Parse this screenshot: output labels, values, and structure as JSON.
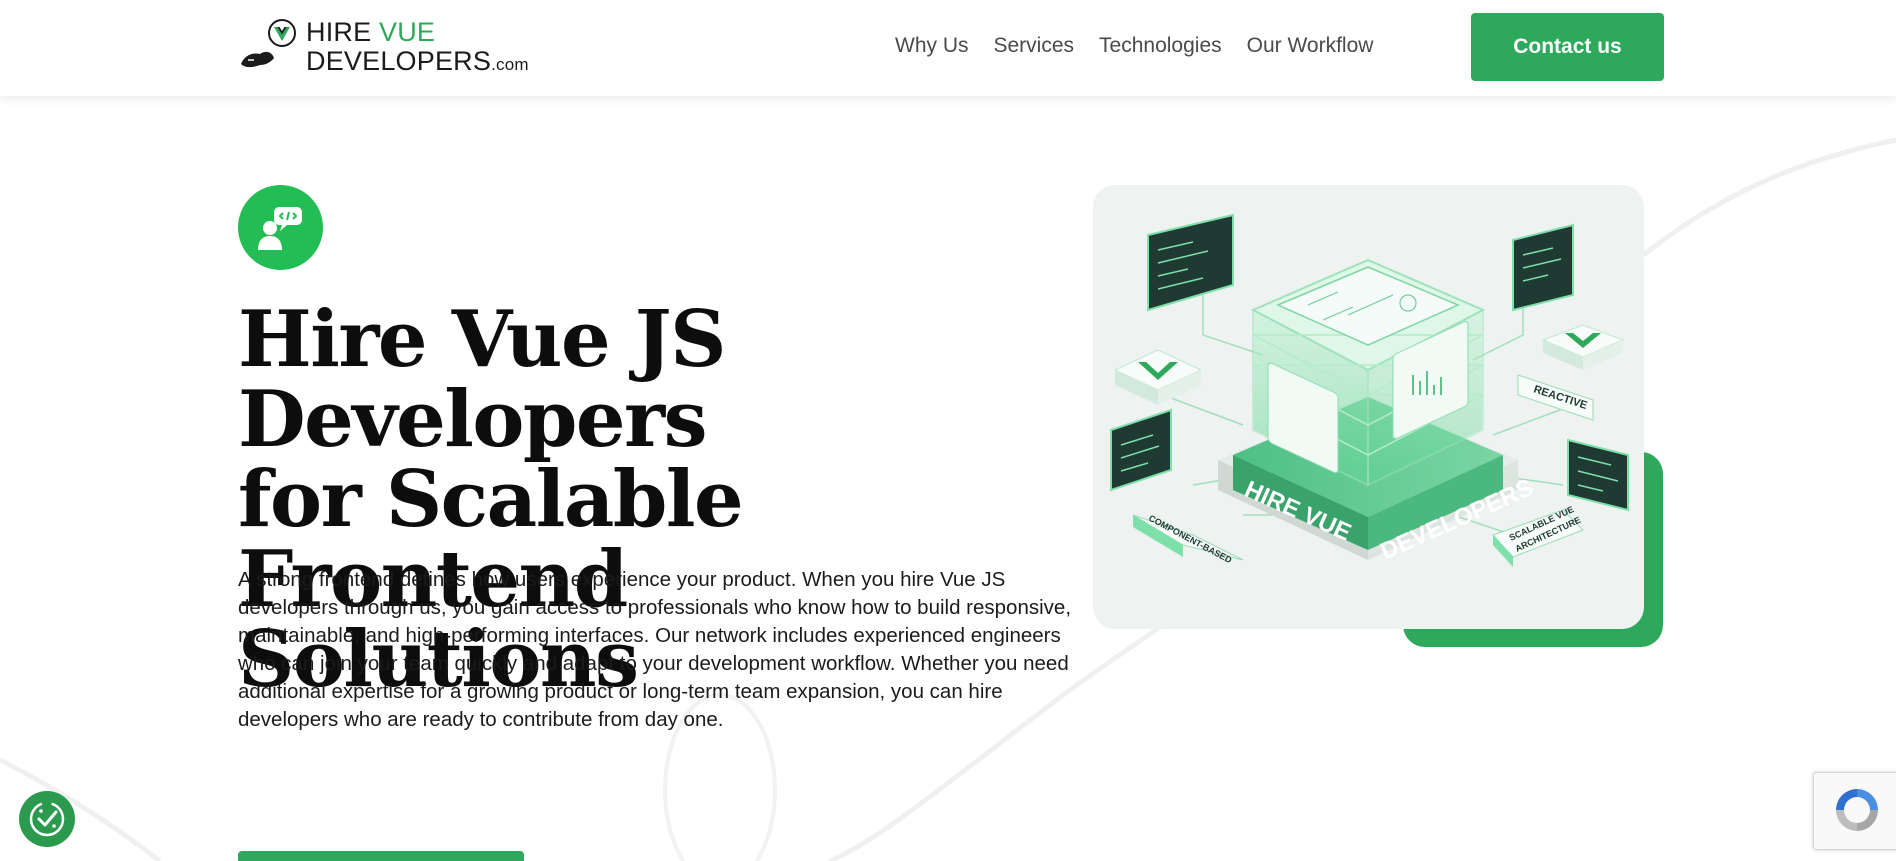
{
  "header": {
    "logo": {
      "word_hire": "HIRE",
      "word_vue": "VUE",
      "word_developers": "DEVELOPERS",
      "word_dotcom": ".com"
    },
    "nav": [
      {
        "label": "Why Us"
      },
      {
        "label": "Services"
      },
      {
        "label": "Technologies"
      },
      {
        "label": "Our Workflow"
      }
    ],
    "contact_label": "Contact us"
  },
  "hero": {
    "badge_icon": "developer-chat-icon",
    "title_line1": "Hire Vue JS Developers",
    "title_line2": "for Scalable Frontend",
    "title_line3": "Solutions",
    "description": "A strong frontend defines how users experience your product. When you hire Vue JS developers through us, you gain access to professionals who know how to build responsive, maintainable, and high-performing interfaces. Our network includes experienced engineers who can join your team quickly and adapt to your development workflow. Whether you need additional expertise for a growing product or long-term team expansion, you can hire developers who are ready to contribute from day one.",
    "image": {
      "label_hire_vue": "HIRE VUE",
      "label_developers": "DEVELOPERS",
      "tag_reactive": "REACTIVE",
      "tag_component": "COMPONENT-BASED",
      "tag_scalable_1": "SCALABLE VUE",
      "tag_scalable_2": "ARCHITECTURE"
    }
  },
  "widgets": {
    "cookie_icon": "cookie-consent-icon",
    "recaptcha_icon": "recaptcha-icon"
  },
  "colors": {
    "brand_green": "#2ea85a",
    "badge_green": "#22bd55",
    "text_dark": "#0d0d0d",
    "nav_gray": "#4a4a4a"
  }
}
